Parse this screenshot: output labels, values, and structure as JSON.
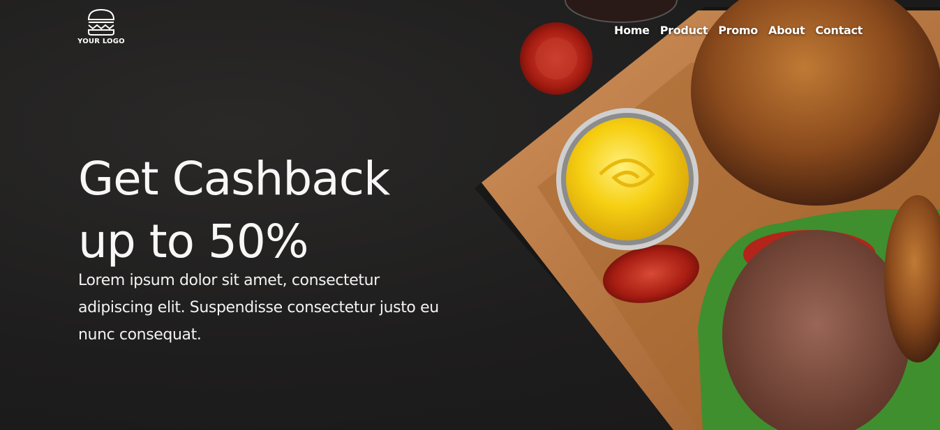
{
  "logo": {
    "text": "YOUR LOGO",
    "icon": "burger-icon"
  },
  "nav": {
    "items": [
      "Home",
      "Product",
      "Promo",
      "About",
      "Contact"
    ]
  },
  "hero": {
    "headline_line1": "Get Cashback",
    "headline_line2": "up to 50%",
    "description": "Lorem ipsum dolor sit amet, consectetur adipiscing elit. Suspendisse consectetur justo eu nunc consequat."
  },
  "colors": {
    "background": "#1d1c1c",
    "text": "#ffffff",
    "board": "#b8733a",
    "sauce": "#f5cc12",
    "bun": "#b56a2a",
    "patty": "#7a4a3a",
    "lettuce": "#3f8f2e",
    "tomato": "#b3241a"
  }
}
